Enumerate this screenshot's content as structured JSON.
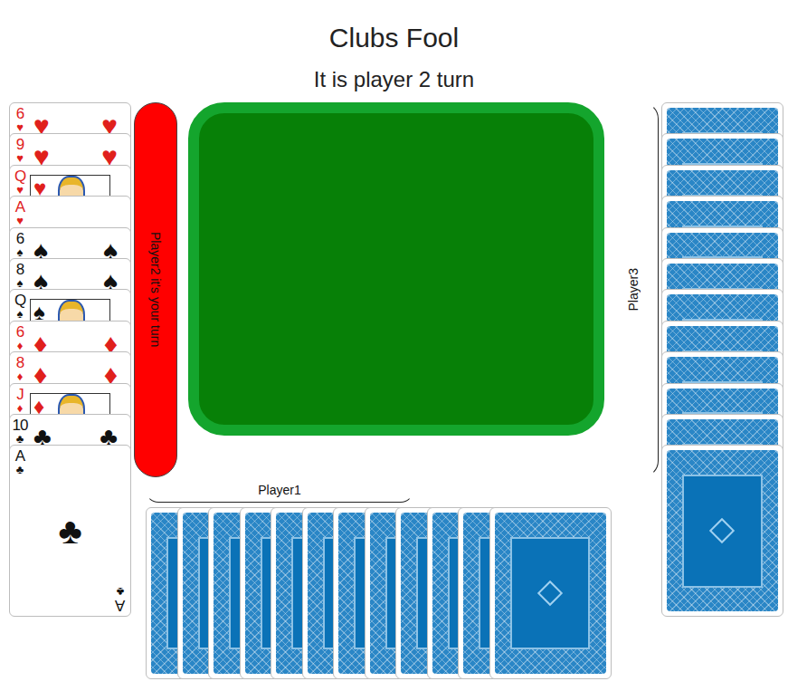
{
  "title": "Clubs Fool",
  "status": "It is player 2 turn",
  "table": {
    "cards": []
  },
  "player1": {
    "label": "Player1",
    "active": false,
    "cards": [
      {
        "face_up": false
      },
      {
        "face_up": false
      },
      {
        "face_up": false
      },
      {
        "face_up": false
      },
      {
        "face_up": false
      },
      {
        "face_up": false
      },
      {
        "face_up": false
      },
      {
        "face_up": false
      },
      {
        "face_up": false
      },
      {
        "face_up": false
      },
      {
        "face_up": false
      },
      {
        "face_up": false
      }
    ]
  },
  "player2": {
    "label": "Player2 it's your turn",
    "active": true,
    "cards": [
      {
        "rank": "6",
        "suit": "♥",
        "kind": "pip",
        "color": "#e0201c",
        "face_up": true
      },
      {
        "rank": "9",
        "suit": "♥",
        "kind": "pip",
        "color": "#e0201c",
        "face_up": true
      },
      {
        "rank": "Q",
        "suit": "♥",
        "kind": "court",
        "color": "#e0201c",
        "face_up": true
      },
      {
        "rank": "A",
        "suit": "♥",
        "kind": "ace",
        "color": "#e0201c",
        "face_up": true
      },
      {
        "rank": "6",
        "suit": "♠",
        "kind": "pip",
        "color": "#111111",
        "face_up": true
      },
      {
        "rank": "8",
        "suit": "♠",
        "kind": "pip",
        "color": "#111111",
        "face_up": true
      },
      {
        "rank": "Q",
        "suit": "♠",
        "kind": "court",
        "color": "#111111",
        "face_up": true
      },
      {
        "rank": "6",
        "suit": "♦",
        "kind": "pip",
        "color": "#e0201c",
        "face_up": true
      },
      {
        "rank": "8",
        "suit": "♦",
        "kind": "pip",
        "color": "#e0201c",
        "face_up": true
      },
      {
        "rank": "J",
        "suit": "♦",
        "kind": "court",
        "color": "#e0201c",
        "face_up": true
      },
      {
        "rank": "10",
        "suit": "♣",
        "kind": "pip",
        "color": "#111111",
        "face_up": true
      },
      {
        "rank": "A",
        "suit": "♣",
        "kind": "ace",
        "color": "#111111",
        "face_up": true
      }
    ]
  },
  "player3": {
    "label": "Player3",
    "active": false,
    "cards": [
      {
        "face_up": false
      },
      {
        "face_up": false
      },
      {
        "face_up": false
      },
      {
        "face_up": false
      },
      {
        "face_up": false
      },
      {
        "face_up": false
      },
      {
        "face_up": false
      },
      {
        "face_up": false
      },
      {
        "face_up": false
      },
      {
        "face_up": false
      },
      {
        "face_up": false
      },
      {
        "face_up": false
      }
    ]
  }
}
